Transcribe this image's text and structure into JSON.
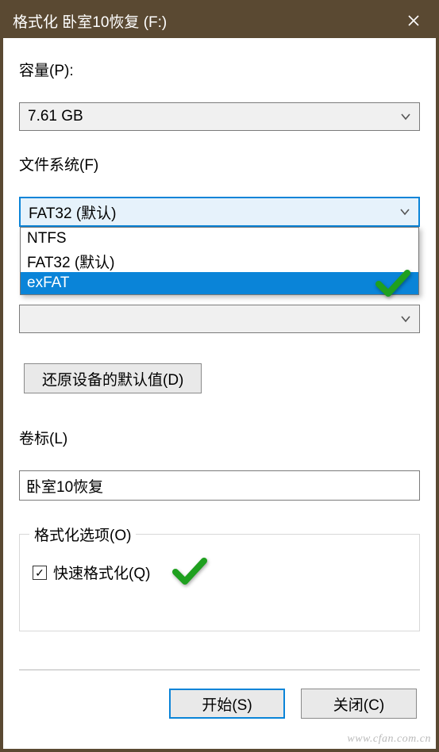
{
  "titlebar": {
    "title": "格式化 卧室10恢复 (F:)"
  },
  "capacity": {
    "label": "容量(P):",
    "value": "7.61 GB"
  },
  "filesystem": {
    "label": "文件系统(F)",
    "value": "FAT32 (默认)",
    "options": [
      "NTFS",
      "FAT32 (默认)",
      "exFAT"
    ],
    "highlighted_index": 2
  },
  "alloc": {
    "partial_text": ""
  },
  "restore_btn": "还原设备的默认值(D)",
  "volume": {
    "label": "卷标(L)",
    "value": "卧室10恢复"
  },
  "options": {
    "legend": "格式化选项(O)",
    "quick_label": "快速格式化(Q)",
    "quick_checked": true
  },
  "actions": {
    "start": "开始(S)",
    "close": "关闭(C)"
  },
  "watermark": "www.cfan.com.cn"
}
